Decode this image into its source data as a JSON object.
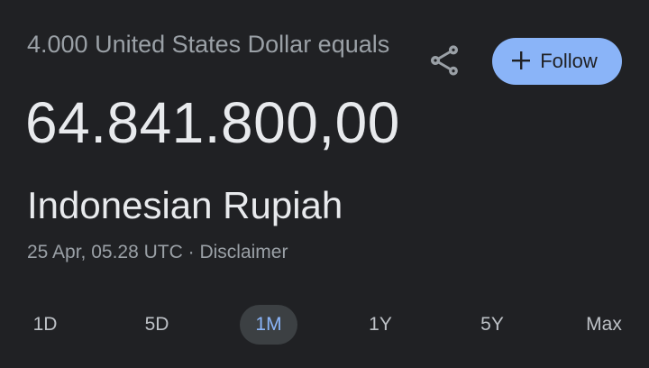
{
  "converter": {
    "from_line": "4.000 United States Dollar equals",
    "amount": "64.841.800,00",
    "to_currency": "Indonesian Rupiah",
    "timestamp": "25 Apr, 05.28 UTC",
    "separator": " · ",
    "disclaimer": "Disclaimer"
  },
  "actions": {
    "share_icon": "share-icon",
    "follow_icon": "plus",
    "follow_label": "Follow"
  },
  "ranges": {
    "selected": "1M",
    "items": [
      {
        "label": "1D"
      },
      {
        "label": "5D"
      },
      {
        "label": "1M"
      },
      {
        "label": "1Y"
      },
      {
        "label": "5Y"
      },
      {
        "label": "Max"
      }
    ]
  },
  "colors": {
    "background": "#202124",
    "accent": "#8ab4f8",
    "primary_text": "#e8eaed",
    "secondary_text": "#9aa0a6",
    "selected_chip": "#3c4043"
  }
}
